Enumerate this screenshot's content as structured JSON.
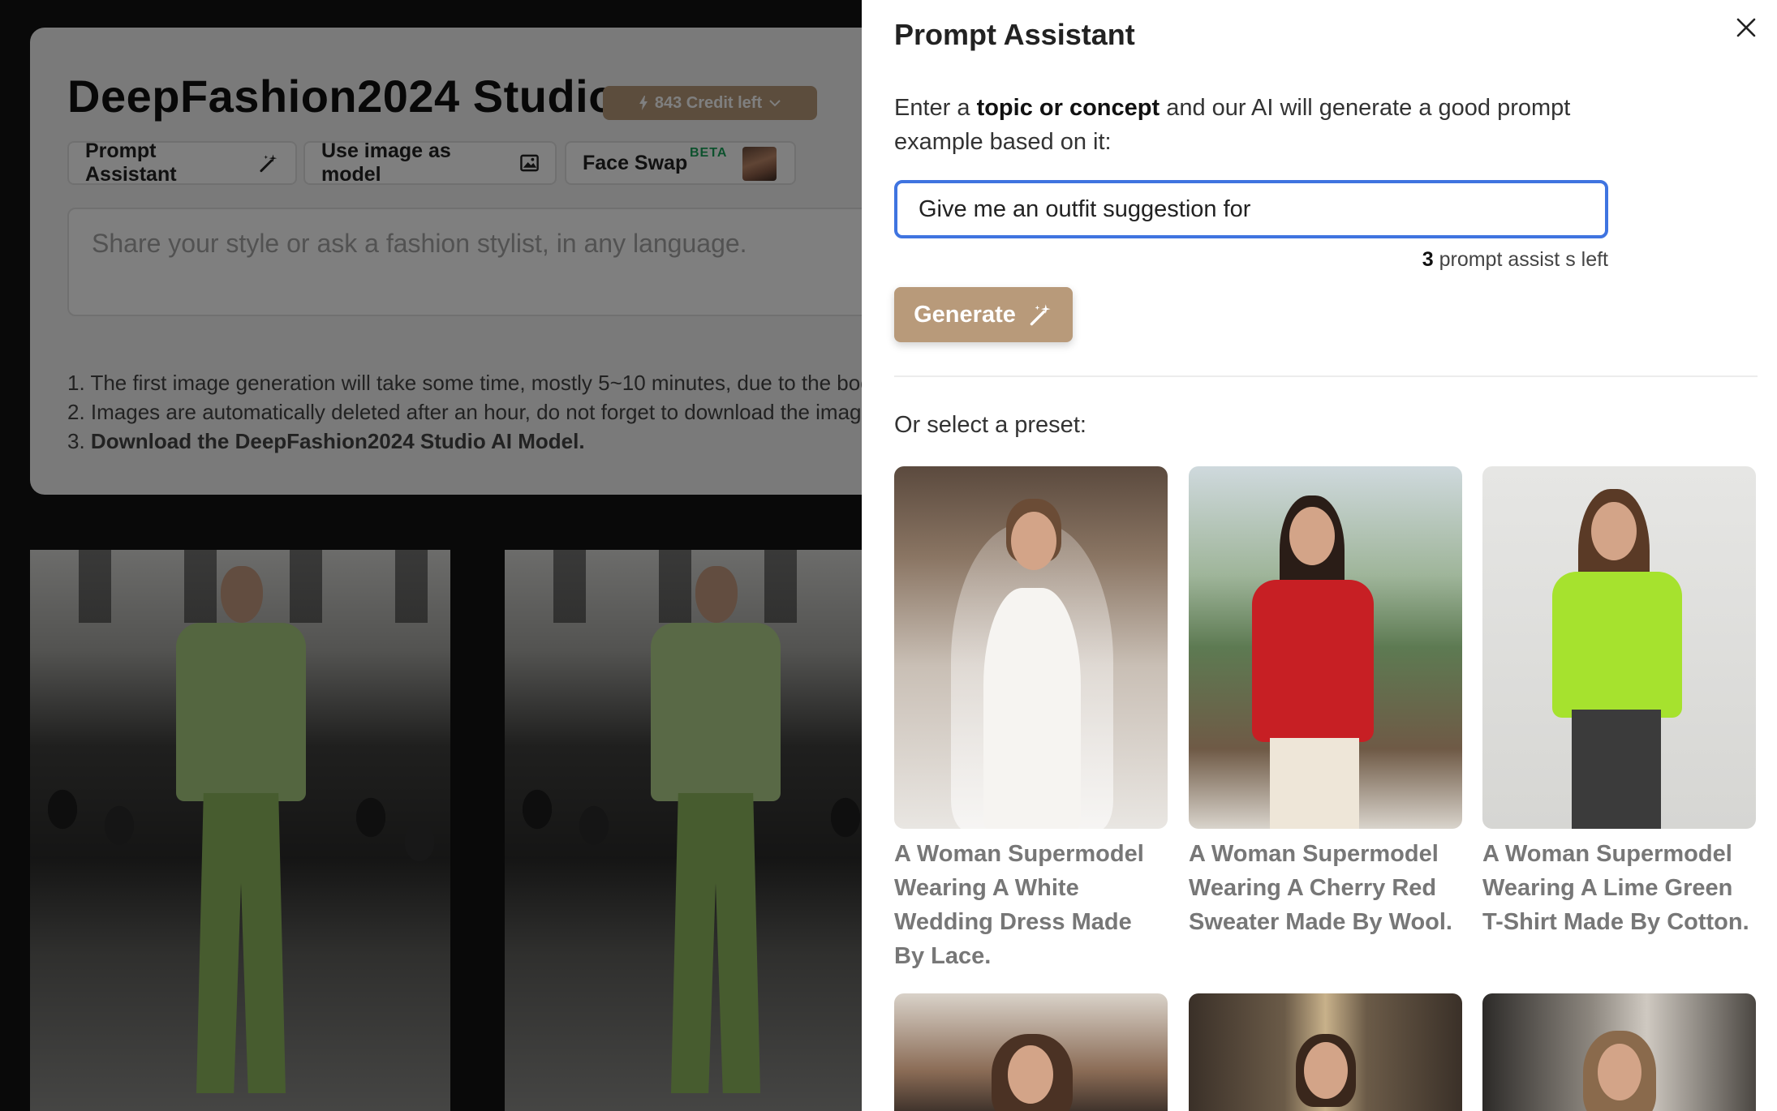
{
  "studio": {
    "title": "DeepFashion2024 Studio",
    "credits": "843 Credit left",
    "buttons": {
      "prompt_assistant": "Prompt Assistant",
      "use_image_as_model": "Use image as model",
      "face_swap": "Face Swap",
      "beta": "BETA"
    },
    "share_placeholder": "Share your style or ask a fashion stylist, in any language.",
    "notes": {
      "line1": "1. The first image generation will take some time, mostly 5~10 minutes, due to the boo",
      "line2": "2. Images are automatically deleted after an hour, do not forget to download the image",
      "line3_prefix": "3. ",
      "line3_bold": "Download the DeepFashion2024 Studio AI Model."
    }
  },
  "drawer": {
    "title": "Prompt Assistant",
    "intro_pre": "Enter a ",
    "intro_bold": "topic or concept",
    "intro_post": " and our AI will generate a good prompt example based on it:",
    "input_value": "Give me an outfit suggestion for ",
    "assists_count": "3",
    "assists_text": " prompt assist s left",
    "generate_label": "Generate",
    "preset_label": "Or select a preset:",
    "presets": [
      {
        "caption": "A Woman Supermodel Wearing A White Wedding Dress Made By Lace."
      },
      {
        "caption": "A Woman Supermodel Wearing A Cherry Red Sweater Made By Wool."
      },
      {
        "caption": "A Woman Supermodel Wearing A Lime Green T-Shirt Made By Cotton."
      }
    ]
  },
  "colors": {
    "accent_brown": "#b89a7a",
    "input_focus": "#3f74e0",
    "beta_green": "#1aa25b"
  },
  "icons": [
    "bolt-icon",
    "chevron-down-icon",
    "magic-wand-icon",
    "image-icon",
    "close-icon"
  ]
}
